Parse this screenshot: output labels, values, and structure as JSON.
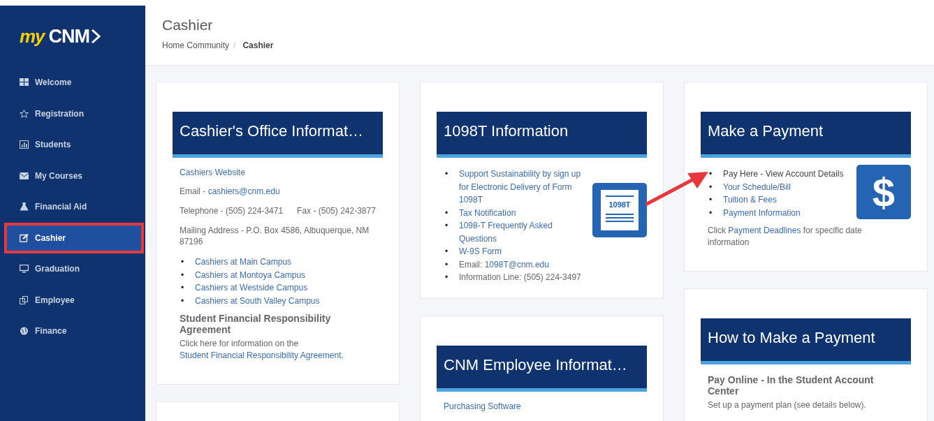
{
  "logo": {
    "prefix": "my",
    "name": "CNM"
  },
  "sidebar": {
    "items": [
      {
        "label": "Welcome",
        "selected": false,
        "highlighted": false
      },
      {
        "label": "Registration",
        "selected": false,
        "highlighted": false
      },
      {
        "label": "Students",
        "selected": false,
        "highlighted": false
      },
      {
        "label": "My Courses",
        "selected": false,
        "highlighted": false
      },
      {
        "label": "Financial Aid",
        "selected": false,
        "highlighted": false
      },
      {
        "label": "Cashier",
        "selected": true,
        "highlighted": true
      },
      {
        "label": "Graduation",
        "selected": false,
        "highlighted": false
      },
      {
        "label": "Employee",
        "selected": false,
        "highlighted": false
      },
      {
        "label": "Finance",
        "selected": false,
        "highlighted": false
      }
    ]
  },
  "header": {
    "title": "Cashier",
    "breadcrumb": [
      {
        "label": "Home Community",
        "current": false,
        "separator": "/"
      },
      {
        "label": "Cashier",
        "current": true
      }
    ]
  },
  "office_card": {
    "title": "Cashier's Office Informat…",
    "website_link": "Cashiers Website",
    "email_label": "Email -",
    "email": "cashiers@cnm.edu",
    "telephone": "Telephone - (505) 224-3471",
    "fax": "Fax - (505) 242-3877",
    "address": "Mailing Address - P.O. Box 4586, Albuquerque, NM 87196",
    "campus_links": [
      {
        "bullet": "•",
        "text": "Cashiers at Main Campus"
      },
      {
        "bullet": "•",
        "text": "Cashiers at Montoya Campus"
      },
      {
        "bullet": "•",
        "text": "Cashiers at Westside Campus"
      },
      {
        "bullet": "•",
        "text": "Cashiers at South Valley Campus"
      }
    ],
    "agreement_heading": "Student Financial Responsibility Agreement",
    "agreement_text": "Click here for information on the",
    "agreement_link": "Student Financial Responsibility Agreement."
  },
  "form_card": {
    "title": "1098T Information",
    "badge": "1098T",
    "items": [
      {
        "kind": "link",
        "bullet": "•",
        "text": "Support Sustainability by sign up for Electronic Delivery of Form 1098T"
      },
      {
        "kind": "link",
        "bullet": "•",
        "text": "Tax Notification"
      },
      {
        "kind": "link",
        "bullet": "•",
        "text": "1098-T Frequently Asked Questions"
      },
      {
        "kind": "link",
        "bullet": "•",
        "text": "W-9S Form"
      },
      {
        "kind": "email",
        "bullet": "•",
        "label": "Email:",
        "link": "1098T@cnm.edu"
      },
      {
        "kind": "text",
        "bullet": "•",
        "text": "Information Line: (505) 224-3497"
      }
    ]
  },
  "employee_card": {
    "title": "CNM Employee Informat…",
    "link": "Purchasing Software"
  },
  "payment_card": {
    "title": "Make a Payment",
    "symbol": "$",
    "items": [
      {
        "bullet": "•",
        "text": "Pay Here - View Account Details",
        "visited": true
      },
      {
        "bullet": "•",
        "text": "Your Schedule/Bill",
        "visited": false
      },
      {
        "bullet": "•",
        "text": "Tuition & Fees",
        "visited": false
      },
      {
        "bullet": "•",
        "text": "Payment Information",
        "visited": false
      }
    ],
    "note_before": "Click",
    "note_link": "Payment Deadlines",
    "note_after": "for specific date information"
  },
  "how_card": {
    "title": "How to Make a Payment",
    "subheading": "Pay Online - In the Student Account Center",
    "text": "Set up a payment plan (see details below)."
  },
  "annotation": {
    "arrow": true
  }
}
